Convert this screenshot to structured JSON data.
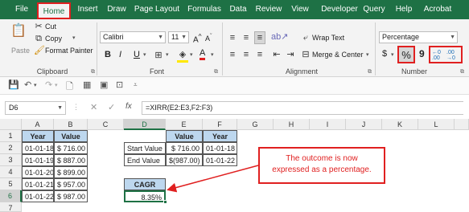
{
  "ribbon_tabs": [
    "File",
    "Home",
    "Insert",
    "Draw",
    "Page Layout",
    "Formulas",
    "Data",
    "Review",
    "View",
    "Developer",
    "Query",
    "Help",
    "Acrobat"
  ],
  "clipboard": {
    "paste": "Paste",
    "cut": "Cut",
    "copy": "Copy",
    "format_painter": "Format Painter",
    "label": "Clipboard"
  },
  "font": {
    "name": "Calibri",
    "size": "11",
    "label": "Font",
    "bold": "B",
    "italic": "I",
    "underline": "U",
    "font_color": "A"
  },
  "alignment": {
    "wrap_text": "Wrap Text",
    "merge_center": "Merge & Center",
    "label": "Alignment"
  },
  "number": {
    "format": "Percentage",
    "label": "Number",
    "currency": "$",
    "percent": "%",
    "comma": "9",
    "increase_decimal": "←0 .00",
    "decrease_decimal": ".00 →0"
  },
  "accent_colors": {
    "ribbon": "#1e7145",
    "highlight": "#e02020",
    "header_fill": "#bdd7ee"
  },
  "formula_bar": {
    "name_box": "D6",
    "formula": "=XIRR(E2:E3,F2:F3)"
  },
  "columns": [
    "A",
    "B",
    "C",
    "D",
    "E",
    "F",
    "G",
    "H",
    "I",
    "J",
    "K",
    "L"
  ],
  "rows": [
    "1",
    "2",
    "3",
    "4",
    "5",
    "6",
    "7"
  ],
  "table1": {
    "headers": [
      "Year",
      "Value"
    ],
    "rows": [
      [
        "01-01-18",
        "$ 716.00"
      ],
      [
        "01-01-19",
        "$ 887.00"
      ],
      [
        "01-01-20",
        "$ 899.00"
      ],
      [
        "01-01-21",
        "$ 957.00"
      ],
      [
        "01-01-22",
        "$ 987.00"
      ]
    ]
  },
  "table2": {
    "headers": [
      "Value",
      "Year"
    ],
    "rows": [
      {
        "label": "Start Value",
        "value": "$ 716.00",
        "year": "01-01-18"
      },
      {
        "label": "End Value",
        "value": "$(987.00)",
        "year": "01-01-22"
      }
    ]
  },
  "cagr": {
    "label": "CAGR",
    "value": "8.35%"
  },
  "callout": {
    "line1": "The outcome is now",
    "line2": "expressed as a percentage."
  }
}
